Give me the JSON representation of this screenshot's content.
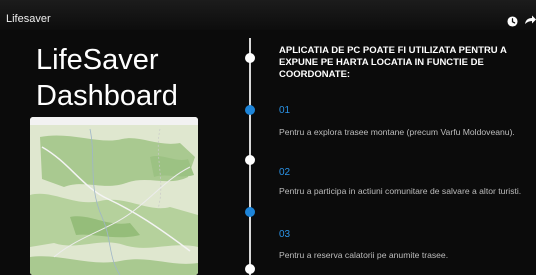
{
  "video": {
    "title": "Lifesaver"
  },
  "icons": {
    "watch_later": "clock-icon",
    "share": "share-arrow-icon"
  },
  "slide": {
    "title_line1": "LifeSaver",
    "title_line2": "Dashboard",
    "heading": "APLICATIA DE PC POATE FI UTILIZATA PENTRU A EXPUNE PE HARTA LOCATIA IN FUNCTIE DE COORDONATE:",
    "items": [
      {
        "num": "01",
        "text": "Pentru a explora trasee montane (precum Varfu Moldoveanu)."
      },
      {
        "num": "02",
        "text": "Pentru a participa in actiuni comunitare de salvare a altor turisti."
      },
      {
        "num": "03",
        "text": "Pentru a reserva calatorii pe anumite trasee."
      }
    ]
  },
  "colors": {
    "background": "#0b0b0b",
    "accent_blue": "#1d84d8",
    "timeline_line": "#d9d9d9",
    "map_forest": "#a9c990",
    "map_open": "#dfe7cf"
  }
}
